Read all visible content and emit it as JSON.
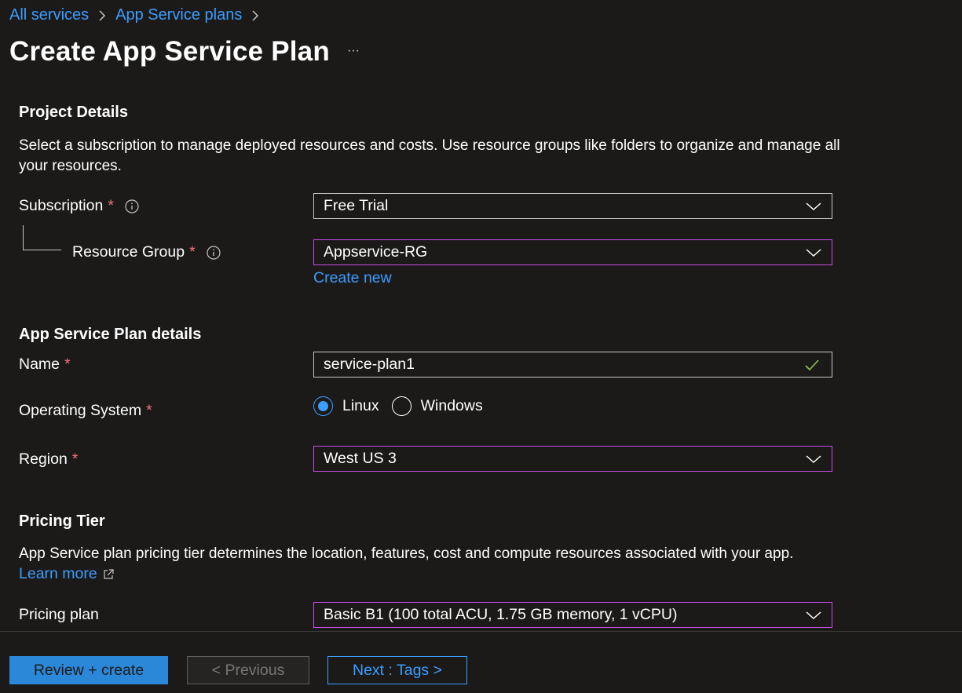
{
  "breadcrumb": {
    "items": [
      "All services",
      "App Service plans"
    ]
  },
  "title": "Create App Service Plan",
  "more_label": "···",
  "project": {
    "heading": "Project Details",
    "description": "Select a subscription to manage deployed resources and costs. Use resource groups like folders to organize and manage all your resources.",
    "subscription_label": "Subscription",
    "subscription_value": "Free Trial",
    "resource_group_label": "Resource Group",
    "resource_group_value": "Appservice-RG",
    "create_new": "Create new"
  },
  "plan": {
    "heading": "App Service Plan details",
    "name_label": "Name",
    "name_value": "service-plan1",
    "os_label": "Operating System",
    "os_options": [
      "Linux",
      "Windows"
    ],
    "os_selected": "Linux",
    "region_label": "Region",
    "region_value": "West US 3"
  },
  "pricing": {
    "heading": "Pricing Tier",
    "description": "App Service plan pricing tier determines the location, features, cost and compute resources associated with your app.",
    "learn_more": "Learn more",
    "plan_label": "Pricing plan",
    "plan_value": "Basic B1 (100 total ACU, 1.75 GB memory, 1 vCPU)"
  },
  "required_marker": "*",
  "footer": {
    "review_create": "Review + create",
    "previous": "< Previous",
    "next": "Next : Tags >"
  },
  "colors": {
    "background": "#1b1a19",
    "link": "#3c9dff",
    "focus_border": "#c74de6",
    "required": "#f1707b",
    "valid_check": "#92c353",
    "primary_button": "#2b88d8"
  }
}
